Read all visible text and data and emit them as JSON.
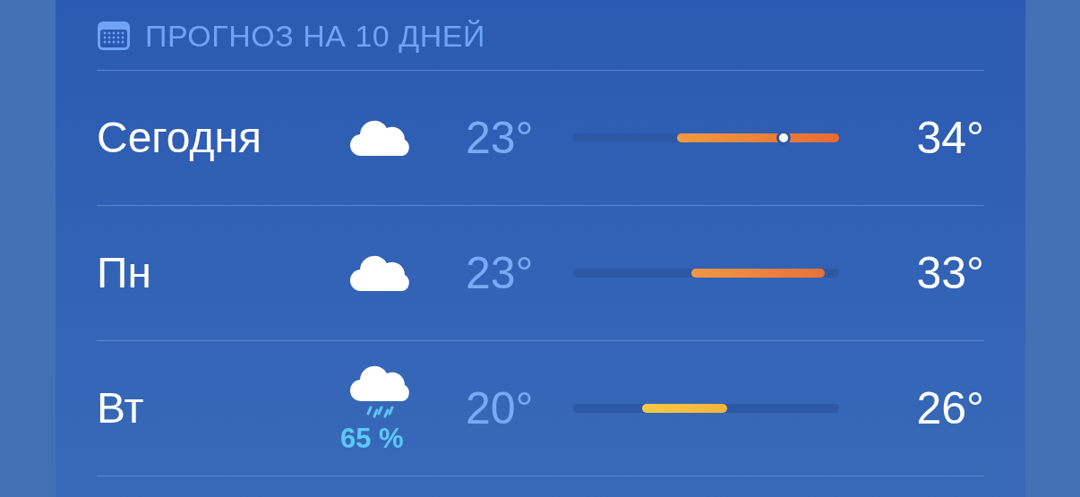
{
  "header": {
    "title": "ПРОГНОЗ НА 10 ДНЕЙ"
  },
  "days": [
    {
      "day": "Сегодня",
      "kind": "cloud",
      "low": "23°",
      "high": "34°",
      "current": {
        "level": 0.79
      }
    },
    {
      "day": "Пн",
      "kind": "cloud",
      "low": "23°",
      "high": "33°"
    },
    {
      "day": "Вт",
      "kind": "rain",
      "precip": "65 %",
      "low": "20°",
      "high": "26°"
    }
  ]
}
